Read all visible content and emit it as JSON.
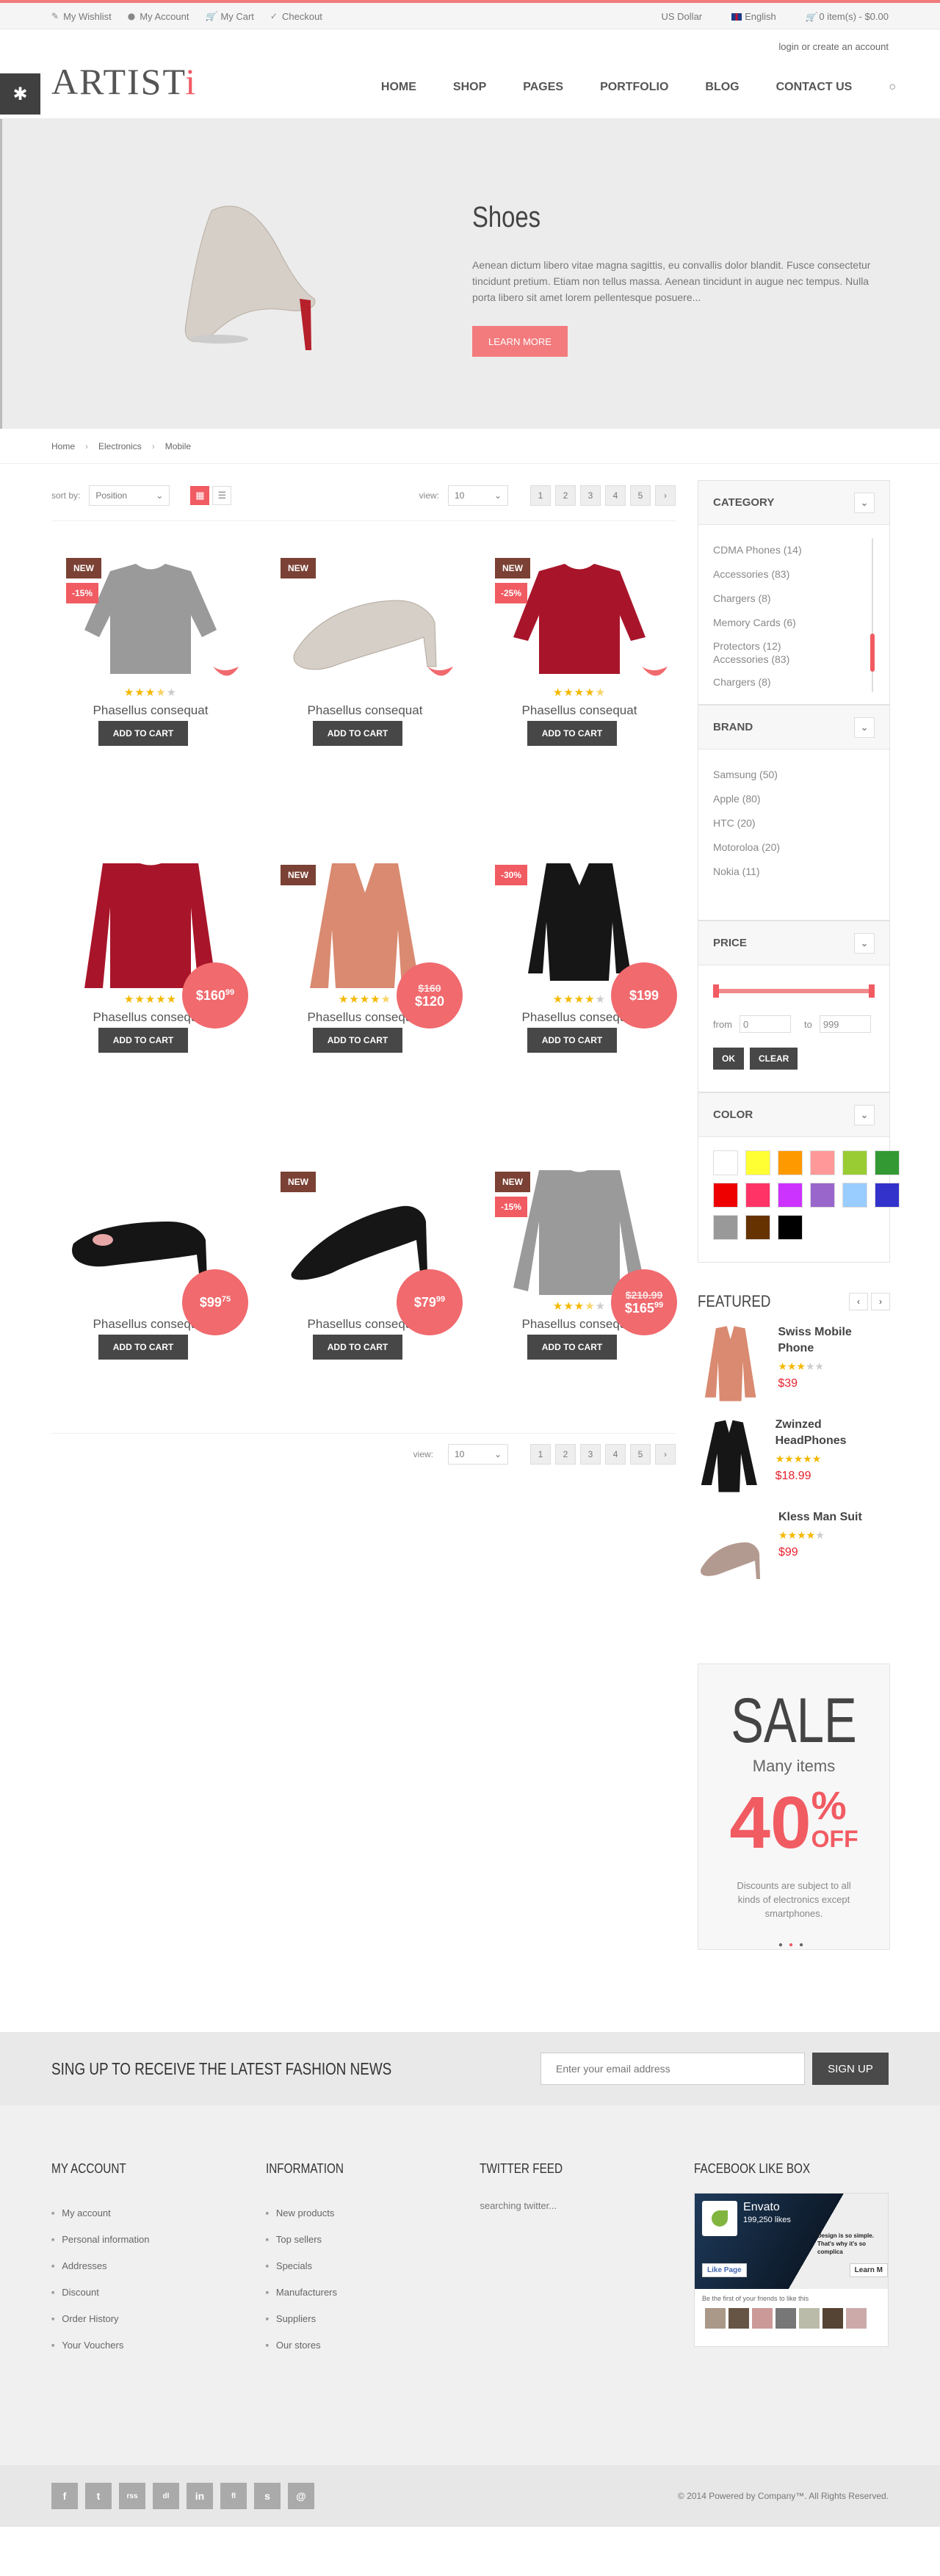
{
  "topbar": {
    "links": [
      "My Wishlist",
      "My Account",
      "My Cart",
      "Checkout"
    ],
    "currency": "US Dollar",
    "language": "English",
    "cart": "0 item(s) - $0.00"
  },
  "header": {
    "login": "login or create an account",
    "logo": "ARTIST",
    "logo_accent": "i",
    "nav": [
      "HOME",
      "SHOP",
      "PAGES",
      "PORTFOLIO",
      "BLOG",
      "CONTACT US"
    ]
  },
  "hero": {
    "title": "Shoes",
    "text": "Aenean dictum libero vitae magna sagittis, eu convallis dolor blandit. Fusce consectetur tincidunt pretium. Etiam non tellus massa. Aenean tincidunt in augue nec tempus. Nulla porta libero sit amet lorem pellentesque posuere...",
    "button": "LEARN MORE"
  },
  "breadcrumb": [
    "Home",
    "Electronics",
    "Mobile"
  ],
  "toolbar": {
    "sort_label": "sort by:",
    "sort_value": "Position",
    "view_label": "view:",
    "view_value": "10",
    "pages": [
      "1",
      "2",
      "3",
      "4",
      "5",
      "›"
    ]
  },
  "products": [
    {
      "name": "Phasellus consequat",
      "cart": "ADD TO CART",
      "badge": "NEW",
      "discount": "-15%",
      "rating": 3.5,
      "price": "",
      "old_price": "",
      "cart_price": ""
    },
    {
      "name": "Phasellus consequat",
      "cart": "ADD TO CART",
      "badge": "NEW",
      "discount": "",
      "rating": 0,
      "price": ""
    },
    {
      "name": "Phasellus consequat",
      "cart": "ADD TO CART",
      "badge": "NEW",
      "discount": "-25%",
      "rating": 4.5,
      "price": ""
    },
    {
      "name": "Phasellus consequat",
      "cart": "ADD TO CART",
      "badge": "",
      "discount": "",
      "rating": 5,
      "price": "$160",
      "price_cents": "99"
    },
    {
      "name": "Phasellus consequat",
      "cart": "ADD TO CART",
      "badge": "NEW",
      "discount": "",
      "rating": 4.5,
      "old_price": "$160",
      "price": "$120"
    },
    {
      "name": "Phasellus consequat",
      "cart": "ADD TO CART",
      "badge": "",
      "discount": "-30%",
      "rating": 4,
      "price": "$199"
    },
    {
      "name": "Phasellus consequat",
      "cart": "ADD TO CART",
      "badge": "",
      "discount": "",
      "rating": 0,
      "price": "$99",
      "price_cents": "75"
    },
    {
      "name": "Phasellus consequat",
      "cart": "ADD TO CART",
      "badge": "NEW",
      "discount": "",
      "rating": 0,
      "price": "$79",
      "price_cents": "99"
    },
    {
      "name": "Phasellus consequat",
      "cart": "ADD TO CART",
      "badge": "NEW",
      "discount": "-15%",
      "rating": 3.5,
      "old_price": "$210.99",
      "price": "$165",
      "price_cents": "99"
    }
  ],
  "sidebar": {
    "category": {
      "title": "CATEGORY",
      "items": [
        "CDMA Phones (14)",
        "Accessories (83)",
        "Chargers (8)",
        "Memory Cards (6)",
        "Protectors (12)",
        "Accessories (83)",
        "Chargers (8)"
      ]
    },
    "brand": {
      "title": "BRAND",
      "items": [
        "Samsung (50)",
        "Apple (80)",
        "HTC (20)",
        "Motoroloa (20)",
        "Nokia (11)"
      ]
    },
    "price": {
      "title": "PRICE",
      "from_label": "from",
      "from_value": "0",
      "to_label": "to",
      "to_value": "999",
      "ok": "OK",
      "clear": "CLEAR"
    },
    "color": {
      "title": "COLOR",
      "swatches": [
        "#ffffff",
        "#ffff33",
        "#ff9900",
        "#ff9999",
        "#99cc33",
        "#339933",
        "#ee0000",
        "#ff3366",
        "#cc33ff",
        "#9966cc",
        "#99ccff",
        "#3333cc",
        "#999999",
        "#663300",
        "#000000"
      ]
    },
    "featured": {
      "title": "FEATURED",
      "items": [
        {
          "name": "Swiss Mobile Phone",
          "price": "$39",
          "rating": 3
        },
        {
          "name": "Zwinzed HeadPhones",
          "price": "$18.99",
          "rating": 5
        },
        {
          "name": "Kless Man Suit",
          "price": "$99",
          "rating": 4
        }
      ]
    },
    "sale": {
      "title": "SALE",
      "sub": "Many items",
      "percent": "40",
      "percent_sign": "%",
      "off": "OFF",
      "note": "Discounts are subject to all kinds of electronics except smartphones."
    }
  },
  "newsletter": {
    "title": "SING UP TO RECEIVE THE LATEST FASHION NEWS",
    "placeholder": "Enter your email address",
    "button": "SIGN UP"
  },
  "footer": {
    "account": {
      "title": "MY ACCOUNT",
      "items": [
        "My account",
        "Personal information",
        "Addresses",
        "Discount",
        "Order History",
        "Your Vouchers"
      ]
    },
    "info": {
      "title": "INFORMATION",
      "items": [
        "New products",
        "Top sellers",
        "Specials",
        "Manufacturers",
        "Suppliers",
        "Our stores"
      ]
    },
    "twitter": {
      "title": "TWITTER FEED",
      "text": "searching twitter..."
    },
    "facebook": {
      "title": "FACEBOOK LIKE BOX",
      "page": "Envato",
      "likes": "199,250 likes",
      "like_btn": "Like Page",
      "learn": "Learn M",
      "friends": "Be the first of your friends to like this",
      "tagline": "Design is so simple. That's why it's so complica"
    },
    "social": [
      "f",
      "t",
      "rss",
      "dl",
      "in",
      "fl",
      "s",
      "@"
    ],
    "copyright": "© 2014 Powered by Company™. All Rights Reserved."
  }
}
